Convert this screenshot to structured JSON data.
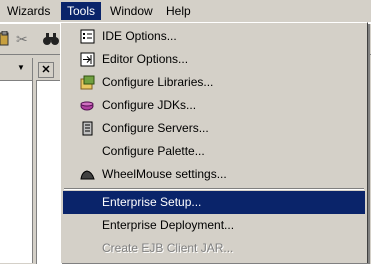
{
  "menubar": {
    "items": [
      "Wizards",
      "Tools",
      "Window",
      "Help"
    ]
  },
  "toolbar": {
    "icons": [
      "paste-icon",
      "cut-icon",
      "find-icon"
    ]
  },
  "left_panel": {
    "dropdown_arrow": "▼"
  },
  "editor_tab": {
    "close_glyph": "✕"
  },
  "tools_menu": {
    "items": [
      {
        "label": "IDE Options...",
        "icon": "ide-options-icon",
        "state": "normal"
      },
      {
        "label": "Editor Options...",
        "icon": "editor-options-icon",
        "state": "normal"
      },
      {
        "label": "Configure Libraries...",
        "icon": "configure-libraries-icon",
        "state": "normal"
      },
      {
        "label": "Configure JDKs...",
        "icon": "configure-jdks-icon",
        "state": "normal"
      },
      {
        "label": "Configure Servers...",
        "icon": "configure-servers-icon",
        "state": "normal"
      },
      {
        "label": "Configure Palette...",
        "icon": "",
        "state": "normal"
      },
      {
        "label": "WheelMouse settings...",
        "icon": "wheelmouse-icon",
        "state": "normal"
      },
      {
        "label": "Enterprise Setup...",
        "icon": "",
        "state": "highlighted"
      },
      {
        "label": "Enterprise Deployment...",
        "icon": "",
        "state": "normal"
      },
      {
        "label": "Create EJB Client JAR...",
        "icon": "",
        "state": "disabled"
      }
    ]
  },
  "colors": {
    "highlight": "#0a246a",
    "face": "#d4d0c8",
    "disabled_text": "#808080"
  }
}
